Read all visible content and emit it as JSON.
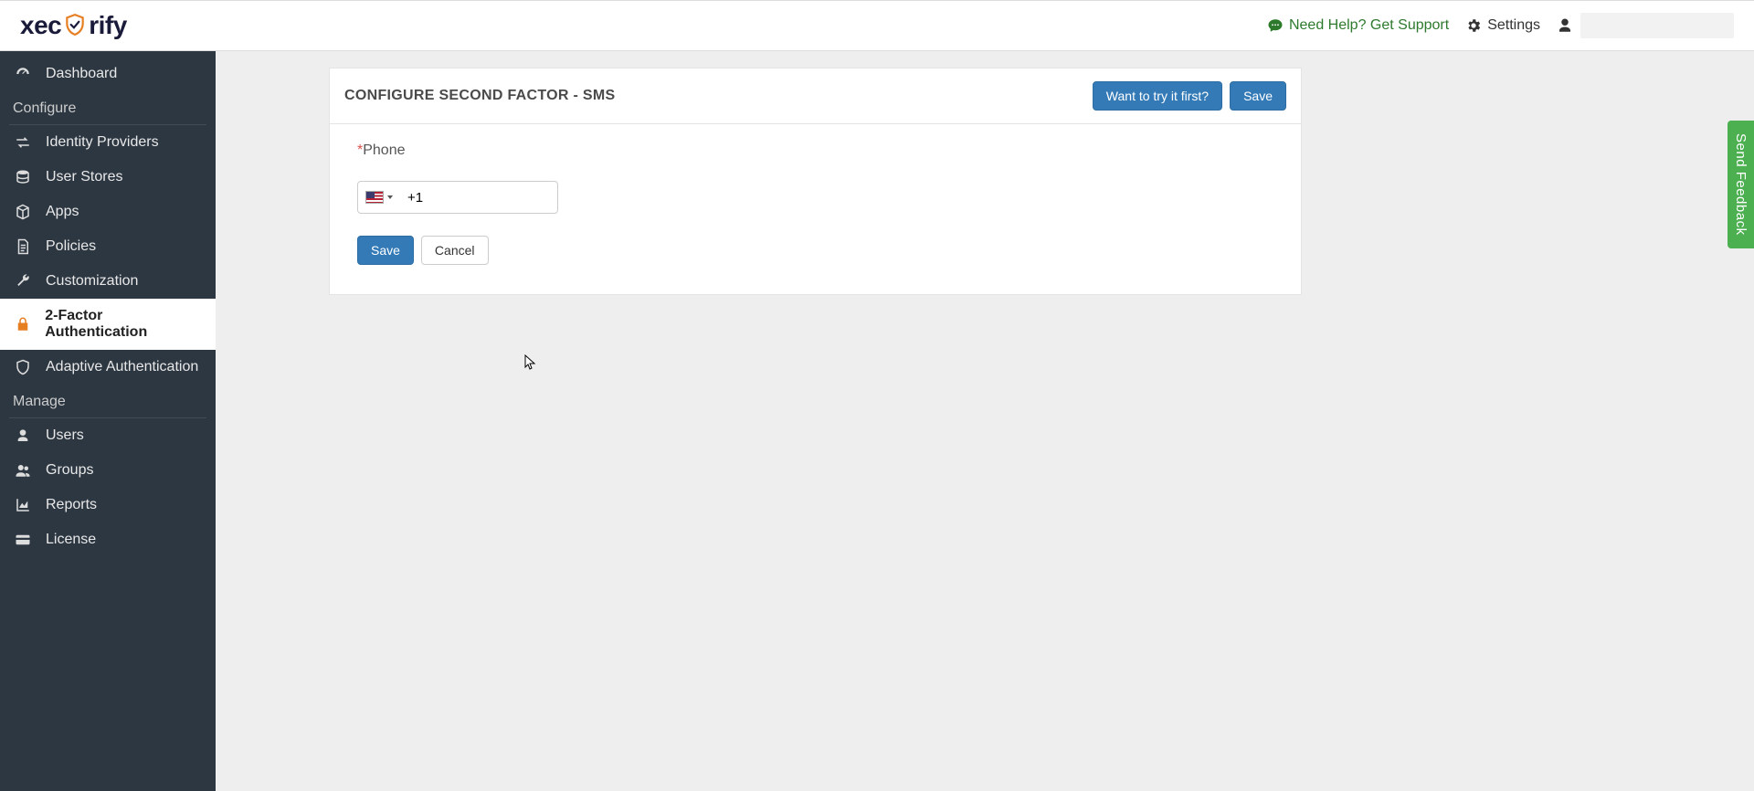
{
  "header": {
    "logo_pre": "xec",
    "logo_post": "rify",
    "support_label": "Need Help? Get Support",
    "settings_label": "Settings"
  },
  "sidebar": {
    "dashboard": "Dashboard",
    "section_configure": "Configure",
    "identity_providers": "Identity Providers",
    "user_stores": "User Stores",
    "apps": "Apps",
    "policies": "Policies",
    "customization": "Customization",
    "two_factor": "2-Factor Authentication",
    "adaptive_auth": "Adaptive Authentication",
    "section_manage": "Manage",
    "users": "Users",
    "groups": "Groups",
    "reports": "Reports",
    "license": "License"
  },
  "panel": {
    "title": "CONFIGURE SECOND FACTOR - SMS",
    "try_first": "Want to try it first?",
    "save_top": "Save",
    "phone_label": "Phone",
    "country_code": "+1",
    "save": "Save",
    "cancel": "Cancel"
  },
  "feedback": {
    "label": "Send Feedback"
  }
}
